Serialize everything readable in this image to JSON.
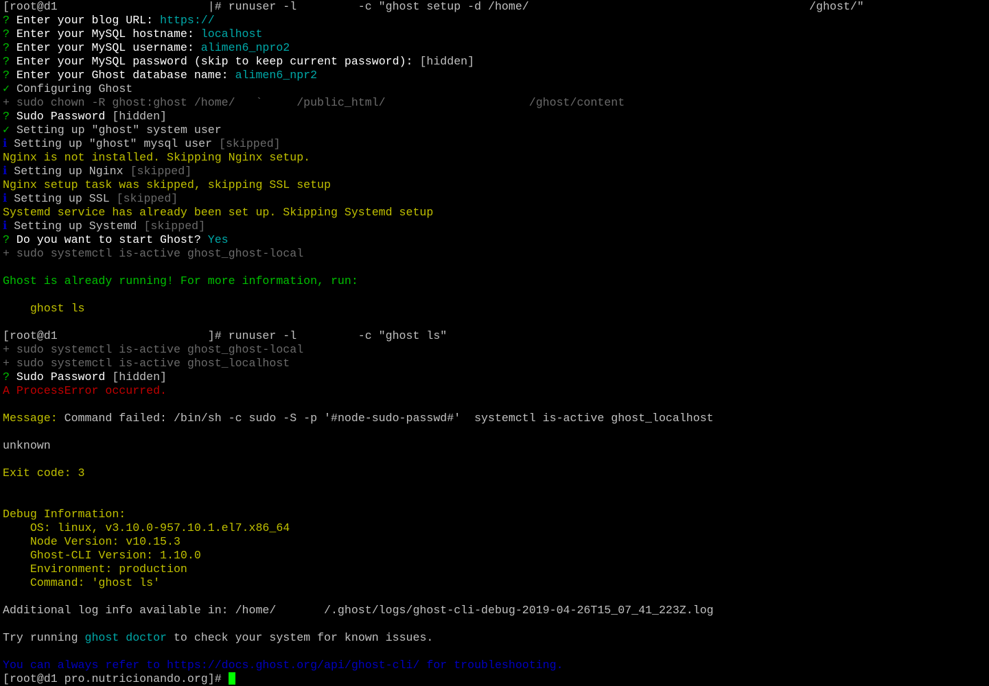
{
  "colors": {
    "background": "#000000",
    "default": "#c0c0c0",
    "white": "#ffffff",
    "green": "#00c000",
    "cyan": "#00a8a8",
    "yellow": "#c0c000",
    "gray": "#6a6a6a",
    "red": "#c00000",
    "blue": "#0000c0",
    "cursor": "#00ff00"
  },
  "lines": [
    [
      [
        "default",
        "[root@d1                      |# runuser -l         -c \"ghost setup -d /home/                                         /ghost/\""
      ]
    ],
    [
      [
        "green",
        "? "
      ],
      [
        "white",
        "Enter your blog URL: "
      ],
      [
        "cyan",
        "https://"
      ]
    ],
    [
      [
        "green",
        "? "
      ],
      [
        "white",
        "Enter your MySQL hostname: "
      ],
      [
        "cyan",
        "localhost"
      ]
    ],
    [
      [
        "green",
        "? "
      ],
      [
        "white",
        "Enter your MySQL username: "
      ],
      [
        "cyan",
        "alimen6_npro2"
      ]
    ],
    [
      [
        "green",
        "? "
      ],
      [
        "white",
        "Enter your MySQL password (skip to keep current password): "
      ],
      [
        "default",
        "[hidden]"
      ]
    ],
    [
      [
        "green",
        "? "
      ],
      [
        "white",
        "Enter your Ghost database name: "
      ],
      [
        "cyan",
        "alimen6_npr2"
      ]
    ],
    [
      [
        "green",
        "✓ "
      ],
      [
        "default",
        "Configuring Ghost"
      ]
    ],
    [
      [
        "gray",
        "+ sudo chown -R ghost:ghost /home/   `     /public_html/                     /ghost/content"
      ]
    ],
    [
      [
        "green",
        "? "
      ],
      [
        "white",
        "Sudo Password "
      ],
      [
        "default",
        "[hidden]"
      ]
    ],
    [
      [
        "green",
        "✓ "
      ],
      [
        "default",
        "Setting up \"ghost\" system user"
      ]
    ],
    [
      [
        "blue",
        "ℹ "
      ],
      [
        "default",
        "Setting up \"ghost\" mysql user "
      ],
      [
        "gray",
        "[skipped]"
      ]
    ],
    [
      [
        "yellow",
        "Nginx is not installed. Skipping Nginx setup."
      ]
    ],
    [
      [
        "blue",
        "ℹ "
      ],
      [
        "default",
        "Setting up Nginx "
      ],
      [
        "gray",
        "[skipped]"
      ]
    ],
    [
      [
        "yellow",
        "Nginx setup task was skipped, skipping SSL setup"
      ]
    ],
    [
      [
        "blue",
        "ℹ "
      ],
      [
        "default",
        "Setting up SSL "
      ],
      [
        "gray",
        "[skipped]"
      ]
    ],
    [
      [
        "yellow",
        "Systemd service has already been set up. Skipping Systemd setup"
      ]
    ],
    [
      [
        "blue",
        "ℹ "
      ],
      [
        "default",
        "Setting up Systemd "
      ],
      [
        "gray",
        "[skipped]"
      ]
    ],
    [
      [
        "green",
        "? "
      ],
      [
        "white",
        "Do you want to start Ghost? "
      ],
      [
        "cyan",
        "Yes"
      ]
    ],
    [
      [
        "gray",
        "+ sudo systemctl is-active ghost_ghost-local"
      ]
    ],
    [],
    [
      [
        "green",
        "Ghost is already running! For more information, run:"
      ]
    ],
    [],
    [
      [
        "yellow",
        "    ghost ls"
      ]
    ],
    [],
    [
      [
        "default",
        "[root@d1                      ]# runuser -l         -c \"ghost ls\""
      ]
    ],
    [
      [
        "gray",
        "+ sudo systemctl is-active ghost_ghost-local"
      ]
    ],
    [
      [
        "gray",
        "+ sudo systemctl is-active ghost_localhost"
      ]
    ],
    [
      [
        "green",
        "? "
      ],
      [
        "white",
        "Sudo Password "
      ],
      [
        "default",
        "[hidden]"
      ]
    ],
    [
      [
        "red",
        "A ProcessError occurred."
      ]
    ],
    [],
    [
      [
        "yellow",
        "Message: "
      ],
      [
        "default",
        "Command failed: /bin/sh -c sudo -S -p '#node-sudo-passwd#'  systemctl is-active ghost_localhost"
      ]
    ],
    [],
    [
      [
        "default",
        "unknown"
      ]
    ],
    [],
    [
      [
        "yellow",
        "Exit code: 3"
      ]
    ],
    [],
    [],
    [
      [
        "yellow",
        "Debug Information:"
      ]
    ],
    [
      [
        "yellow",
        "    OS: linux, v3.10.0-957.10.1.el7.x86_64"
      ]
    ],
    [
      [
        "yellow",
        "    Node Version: v10.15.3"
      ]
    ],
    [
      [
        "yellow",
        "    Ghost-CLI Version: 1.10.0"
      ]
    ],
    [
      [
        "yellow",
        "    Environment: production"
      ]
    ],
    [
      [
        "yellow",
        "    Command: 'ghost ls'"
      ]
    ],
    [],
    [
      [
        "default",
        "Additional log info available in: /home/       /.ghost/logs/ghost-cli-debug-2019-04-26T15_07_41_223Z.log"
      ]
    ],
    [],
    [
      [
        "default",
        "Try running "
      ],
      [
        "cyan",
        "ghost doctor"
      ],
      [
        "default",
        " to check your system for known issues."
      ]
    ],
    [],
    [
      [
        "blue",
        "You can always refer to https://docs.ghost.org/api/ghost-cli/ for troubleshooting."
      ]
    ]
  ],
  "prompt": "[root@d1 pro.nutricionando.org]# "
}
